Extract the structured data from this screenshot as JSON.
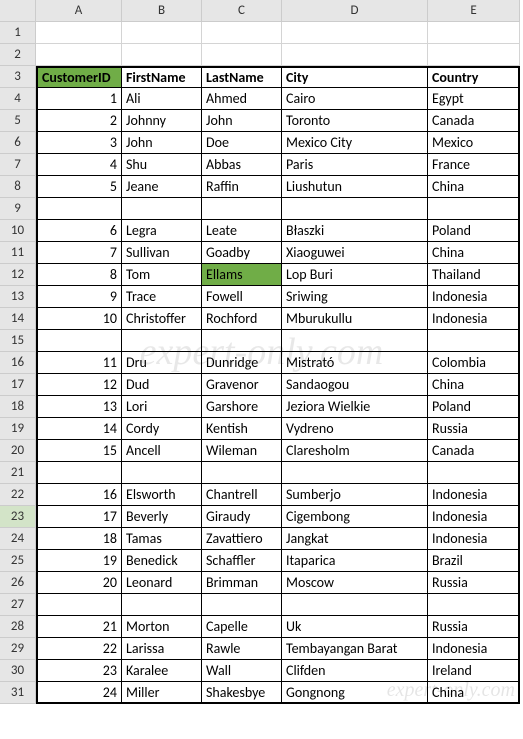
{
  "columns": [
    "A",
    "B",
    "C",
    "D",
    "E"
  ],
  "selected_row_header": 23,
  "highlight": {
    "header_col": 0,
    "cell": {
      "row_idx": 8,
      "col_idx": 2
    }
  },
  "chart_data": {
    "type": "table",
    "headers": [
      "CustomerID",
      "FirstName",
      "LastName",
      "City",
      "Country"
    ],
    "rows": [
      {
        "r": 4,
        "d": [
          "1",
          "Ali",
          "Ahmed",
          "Cairo",
          "Egypt"
        ]
      },
      {
        "r": 5,
        "d": [
          "2",
          "Johnny",
          "John",
          "Toronto",
          "Canada"
        ]
      },
      {
        "r": 6,
        "d": [
          "3",
          "John",
          "Doe",
          "Mexico City",
          "Mexico"
        ]
      },
      {
        "r": 7,
        "d": [
          "4",
          "Shu",
          "Abbas",
          "Paris",
          "France"
        ]
      },
      {
        "r": 8,
        "d": [
          "5",
          "Jeane",
          "Raffin",
          "Liushutun",
          "China"
        ]
      },
      {
        "r": 9,
        "d": [
          "",
          "",
          "",
          "",
          ""
        ]
      },
      {
        "r": 10,
        "d": [
          "6",
          "Legra",
          "Leate",
          "Błaszki",
          "Poland"
        ]
      },
      {
        "r": 11,
        "d": [
          "7",
          "Sullivan",
          "Goadby",
          "Xiaoguwei",
          "China"
        ]
      },
      {
        "r": 12,
        "d": [
          "8",
          "Tom",
          "Ellams",
          "Lop Buri",
          "Thailand"
        ]
      },
      {
        "r": 13,
        "d": [
          "9",
          "Trace",
          "Fowell",
          "Sriwing",
          "Indonesia"
        ]
      },
      {
        "r": 14,
        "d": [
          "10",
          "Christoffer",
          "Rochford",
          "Mburukullu",
          "Indonesia"
        ]
      },
      {
        "r": 15,
        "d": [
          "",
          "",
          "",
          "",
          ""
        ]
      },
      {
        "r": 16,
        "d": [
          "11",
          "Dru",
          "Dunridge",
          "Mistrató",
          "Colombia"
        ]
      },
      {
        "r": 17,
        "d": [
          "12",
          "Dud",
          "Gravenor",
          "Sandaogou",
          "China"
        ]
      },
      {
        "r": 18,
        "d": [
          "13",
          "Lori",
          "Garshore",
          "Jeziora Wielkie",
          "Poland"
        ]
      },
      {
        "r": 19,
        "d": [
          "14",
          "Cordy",
          "Kentish",
          "Vydreno",
          "Russia"
        ]
      },
      {
        "r": 20,
        "d": [
          "15",
          "Ancell",
          "Wileman",
          "Claresholm",
          "Canada"
        ]
      },
      {
        "r": 21,
        "d": [
          "",
          "",
          "",
          "",
          ""
        ]
      },
      {
        "r": 22,
        "d": [
          "16",
          "Elsworth",
          "Chantrell",
          "Sumberjo",
          "Indonesia"
        ]
      },
      {
        "r": 23,
        "d": [
          "17",
          "Beverly",
          "Giraudy",
          "Cigembong",
          "Indonesia"
        ]
      },
      {
        "r": 24,
        "d": [
          "18",
          "Tamas",
          "Zavattiero",
          "Jangkat",
          "Indonesia"
        ]
      },
      {
        "r": 25,
        "d": [
          "19",
          "Benedick",
          "Schaffler",
          "Itaparica",
          "Brazil"
        ]
      },
      {
        "r": 26,
        "d": [
          "20",
          "Leonard",
          "Brimman",
          "Moscow",
          "Russia"
        ]
      },
      {
        "r": 27,
        "d": [
          "",
          "",
          "",
          "",
          ""
        ]
      },
      {
        "r": 28,
        "d": [
          "21",
          "Morton",
          "Capelle",
          "Uk",
          "Russia"
        ]
      },
      {
        "r": 29,
        "d": [
          "22",
          "Larissa",
          "Rawle",
          "Tembayangan Barat",
          "Indonesia"
        ]
      },
      {
        "r": 30,
        "d": [
          "23",
          "Karalee",
          "Wall",
          "Clifden",
          "Ireland"
        ]
      },
      {
        "r": 31,
        "d": [
          "24",
          "Miller",
          "Shakesbye",
          "Gongnong",
          "China"
        ]
      }
    ]
  },
  "watermark": "expert-only.com",
  "watermark2": "expert-only.com"
}
